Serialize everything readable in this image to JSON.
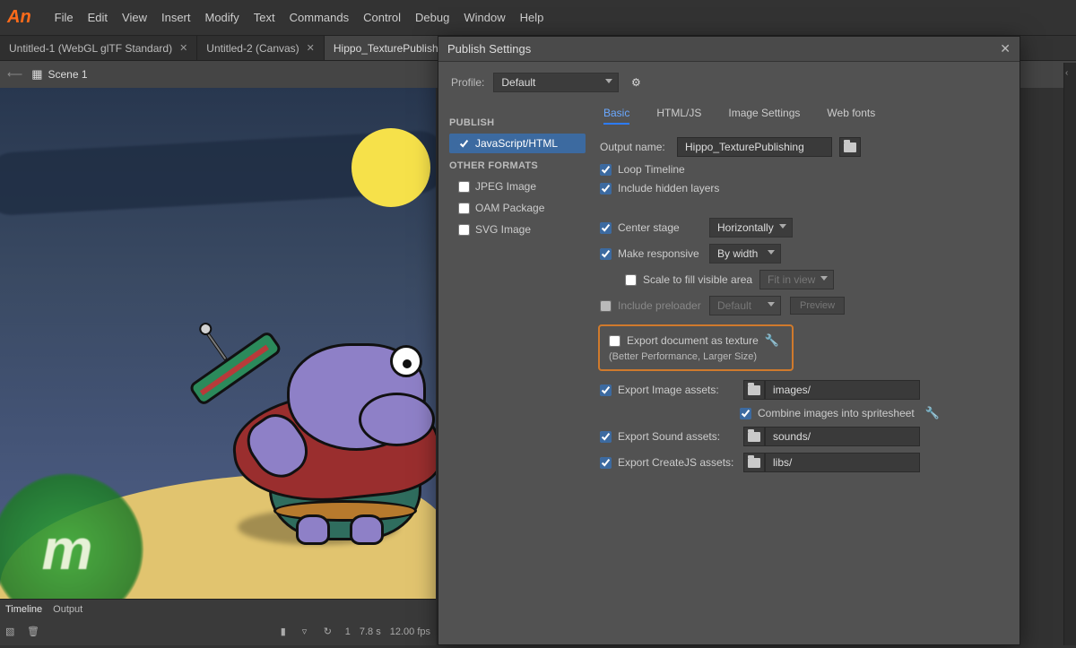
{
  "app": {
    "logo": "An"
  },
  "menu": [
    "File",
    "Edit",
    "View",
    "Insert",
    "Modify",
    "Text",
    "Commands",
    "Control",
    "Debug",
    "Window",
    "Help"
  ],
  "tabs": [
    {
      "label": "Untitled-1 (WebGL glTF Standard)",
      "active": false
    },
    {
      "label": "Untitled-2 (Canvas)",
      "active": false
    },
    {
      "label": "Hippo_TexturePublishi",
      "active": true
    }
  ],
  "scene": {
    "name": "Scene 1"
  },
  "timeline": {
    "tabs": [
      "Timeline",
      "Output"
    ],
    "frame": "1",
    "time": "7.8 s",
    "fps": "12.00 fps"
  },
  "dialog": {
    "title": "Publish Settings",
    "profile_label": "Profile:",
    "profile_value": "Default",
    "sidebar": {
      "publish_header": "PUBLISH",
      "publish_items": [
        {
          "label": "JavaScript/HTML",
          "checked": true
        }
      ],
      "other_header": "OTHER FORMATS",
      "other_items": [
        {
          "label": "JPEG Image",
          "checked": false
        },
        {
          "label": "OAM Package",
          "checked": false
        },
        {
          "label": "SVG Image",
          "checked": false
        }
      ]
    },
    "main_tabs": [
      "Basic",
      "HTML/JS",
      "Image Settings",
      "Web fonts"
    ],
    "output_name_label": "Output name:",
    "output_name_value": "Hippo_TexturePublishing",
    "loop_timeline": "Loop Timeline",
    "include_hidden": "Include hidden layers",
    "center_stage": "Center stage",
    "center_stage_mode": "Horizontally",
    "make_responsive": "Make responsive",
    "responsive_mode": "By width",
    "scale_fill": "Scale to fill visible area",
    "scale_fill_mode": "Fit in view",
    "include_preloader": "Include preloader",
    "preloader_mode": "Default",
    "preview_btn": "Preview",
    "export_texture": "Export document as texture",
    "export_texture_sub": "(Better Performance, Larger Size)",
    "export_image": "Export Image assets:",
    "images_path": "images/",
    "combine_sprites": "Combine images into spritesheet",
    "export_sound": "Export Sound assets:",
    "sounds_path": "sounds/",
    "export_createjs": "Export CreateJS assets:",
    "libs_path": "libs/"
  }
}
